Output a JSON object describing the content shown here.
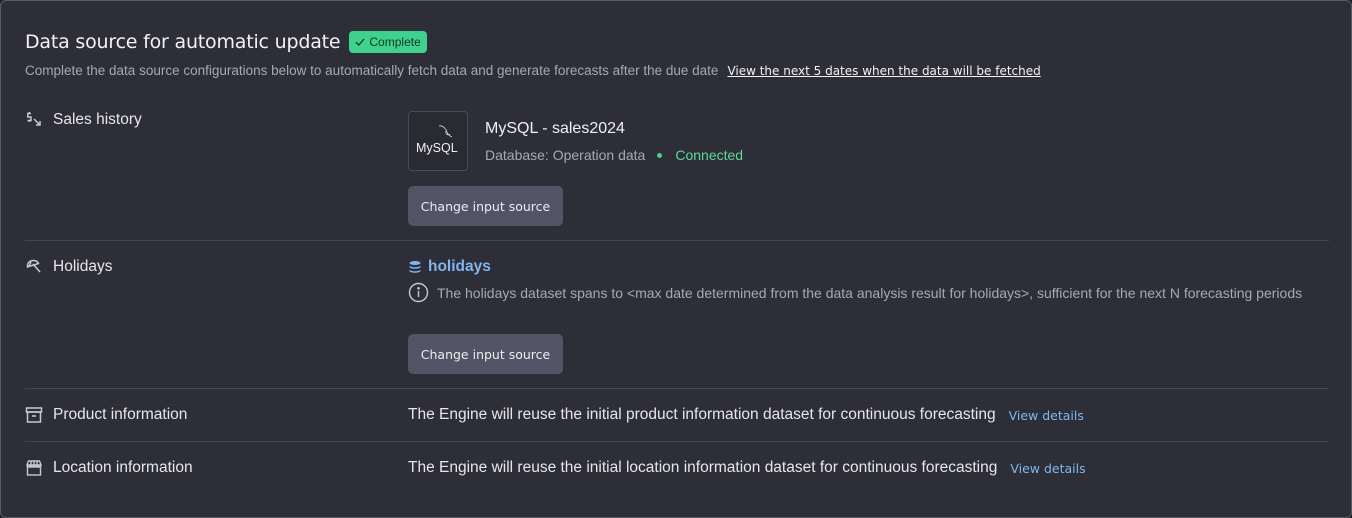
{
  "header": {
    "title": "Data source for automatic update",
    "badge": "Complete",
    "subtitle": "Complete the data source configurations below to automatically fetch data and generate forecasts after the due date",
    "link": "View the next 5 dates when the data will be fetched"
  },
  "sections": {
    "sales": {
      "label": "Sales history",
      "icon": "dollar-trend-down-icon",
      "source_logo": "MySQL",
      "source_name": "MySQL - sales2024",
      "source_meta": "Database: Operation data",
      "status": "Connected",
      "status_color": "#5fd79a",
      "button": "Change input source"
    },
    "holidays": {
      "label": "Holidays",
      "icon": "umbrella-icon",
      "dataset": "holidays",
      "info": "The holidays dataset spans to <max date determined from the data analysis result for holidays>, sufficient for the next N forecasting periods",
      "button": "Change input source"
    },
    "product": {
      "label": "Product information",
      "icon": "archive-box-icon",
      "text": "The Engine will reuse the initial product information dataset for continuous forecasting",
      "link": "View details"
    },
    "location": {
      "label": "Location information",
      "icon": "storefront-icon",
      "text": "The Engine will reuse the initial location information dataset for continuous forecasting",
      "link": "View details"
    }
  },
  "colors": {
    "background": "#2e2e38",
    "accent_link": "#7fb6ee",
    "badge": "#3fd28f",
    "button": "#535366"
  }
}
